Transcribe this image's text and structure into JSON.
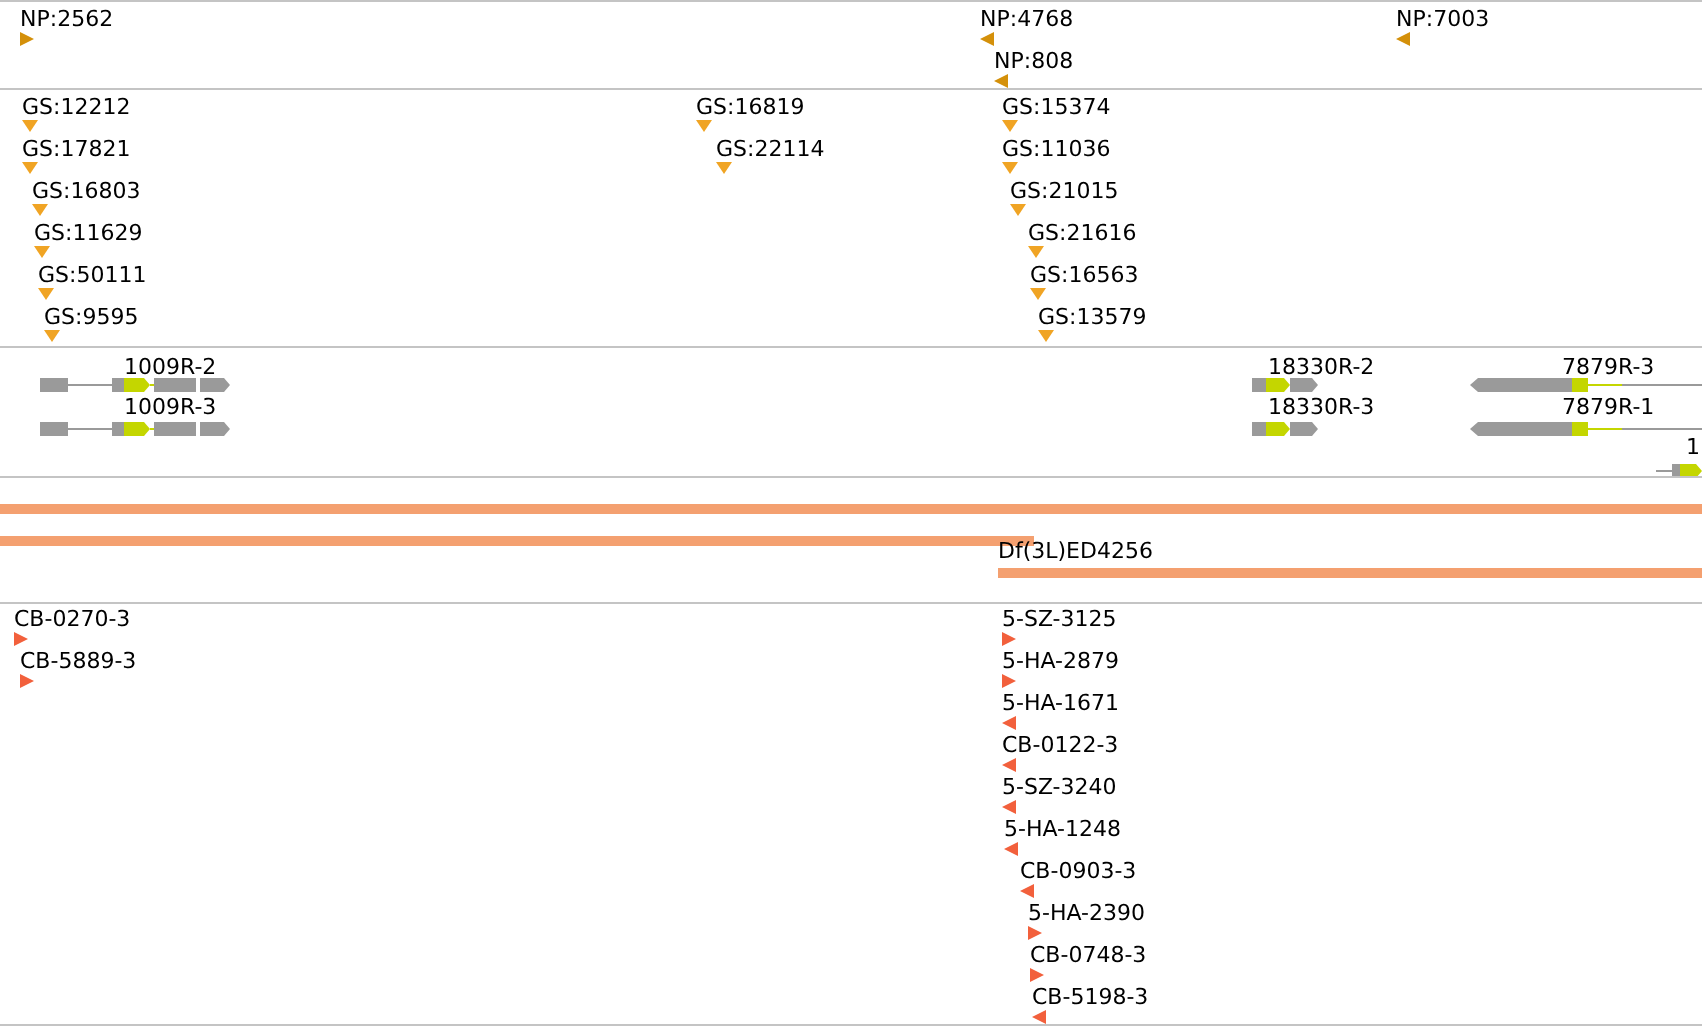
{
  "tracks": [
    {
      "kind": "markers",
      "features": [
        {
          "label": "NP:2562",
          "reverse": false
        },
        {
          "label": "NP:4768",
          "reverse": true
        },
        {
          "label": "NP:808",
          "reverse": true
        },
        {
          "label": "NP:7003",
          "reverse": true
        }
      ]
    },
    {
      "kind": "down-markers",
      "features": [
        {
          "label": "GS:12212"
        },
        {
          "label": "GS:17821"
        },
        {
          "label": "GS:16803"
        },
        {
          "label": "GS:11629"
        },
        {
          "label": "GS:50111"
        },
        {
          "label": "GS:9595"
        },
        {
          "label": "GS:16819"
        },
        {
          "label": "GS:22114"
        },
        {
          "label": "GS:15374"
        },
        {
          "label": "GS:11036"
        },
        {
          "label": "GS:21015"
        },
        {
          "label": "GS:21616"
        },
        {
          "label": "GS:16563"
        },
        {
          "label": "GS:13579"
        }
      ]
    },
    {
      "kind": "genes",
      "features": [
        {
          "label": "1009R-2",
          "reverse": false
        },
        {
          "label": "1009R-3",
          "reverse": false
        },
        {
          "label": "18330R-2",
          "reverse": false
        },
        {
          "label": "18330R-3",
          "reverse": false
        },
        {
          "label": "7879R-3",
          "reverse": true
        },
        {
          "label": "7879R-1",
          "reverse": true
        },
        {
          "label": "1",
          "reverse": false
        }
      ]
    },
    {
      "kind": "bars",
      "features": [
        {
          "kind": "unlabeled"
        },
        {
          "kind": "unlabeled"
        },
        {
          "kind": "labeled",
          "label": "Df(3L)ED4256"
        }
      ]
    },
    {
      "kind": "markers",
      "features": [
        {
          "label": "CB-0270-3",
          "reverse": false
        },
        {
          "label": "CB-5889-3",
          "reverse": false
        },
        {
          "label": "5-SZ-3125",
          "reverse": false
        },
        {
          "label": "5-HA-2879",
          "reverse": false
        },
        {
          "label": "5-HA-1671",
          "reverse": true
        },
        {
          "label": "CB-0122-3",
          "reverse": true
        },
        {
          "label": "5-SZ-3240",
          "reverse": true
        },
        {
          "label": "5-HA-1248",
          "reverse": true
        },
        {
          "label": "CB-0903-3",
          "reverse": true
        },
        {
          "label": "5-HA-2390",
          "reverse": false
        },
        {
          "label": "CB-0748-3",
          "reverse": false
        },
        {
          "label": "CB-5198-3",
          "reverse": true
        }
      ]
    }
  ]
}
